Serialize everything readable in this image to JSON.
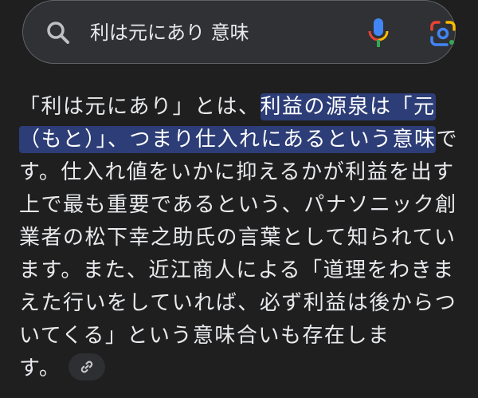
{
  "search": {
    "query": "利は元にあり 意味"
  },
  "answer": {
    "line1_plain": "「利は元にあり」とは、",
    "line1_hl": "利益の源泉は「元",
    "line2_hl": "（もと）」、つまり仕入れにあるという意味",
    "line2_plain": "で",
    "line3": "す。仕入れ値をいかに抑えるかが利益を出す",
    "line4": "上で最も重要であるという、パナソニック創",
    "line5": "業者の松下幸之助氏の言葉として知られてい",
    "line6": "ます。また、近江商人による「道理をわきま",
    "line7": "えた行いをしていれば、必ず利益は後からつ",
    "line8": "いてくる」という意味合いも存在しま",
    "line9": "す。"
  },
  "colors": {
    "background": "#1f1f1f",
    "search_bg": "#303134",
    "highlight": "#2c3d77",
    "text": "#e8eaed"
  },
  "icons": [
    "search-icon",
    "microphone-icon",
    "google-lens-icon",
    "link-icon"
  ]
}
